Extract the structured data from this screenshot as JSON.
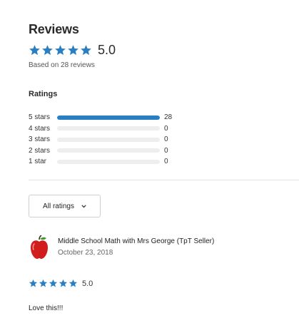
{
  "reviews_section": {
    "heading": "Reviews",
    "average_rating": "5.0",
    "average_stars": 5,
    "based_on": "Based on 28 reviews"
  },
  "ratings": {
    "title": "Ratings",
    "rows": [
      {
        "label": "5 stars",
        "count": "28",
        "fraction": 1.0
      },
      {
        "label": "4 stars",
        "count": "0",
        "fraction": 0
      },
      {
        "label": "3 stars",
        "count": "0",
        "fraction": 0
      },
      {
        "label": "2 stars",
        "count": "0",
        "fraction": 0
      },
      {
        "label": "1 star",
        "count": "0",
        "fraction": 0
      }
    ]
  },
  "filter": {
    "selected": "All ratings",
    "icon": "chevron-down-icon"
  },
  "review": {
    "avatar_icon": "apple-icon",
    "author": "Middle School Math with Mrs George (TpT Seller)",
    "date": "October 23, 2018",
    "stars": 5,
    "score": "5.0",
    "text": "Love this!!!"
  },
  "colors": {
    "accent": "#2a7fc2",
    "track": "#eeeeee",
    "avatar_red": "#d21d1d"
  }
}
